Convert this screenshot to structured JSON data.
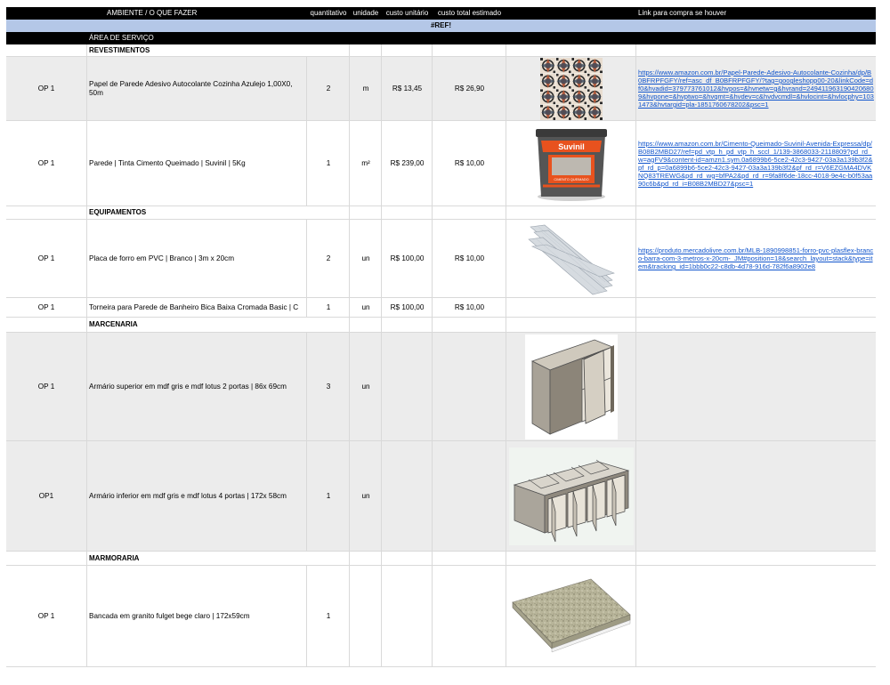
{
  "headers": {
    "ambiente": "AMBIENTE / O QUE FAZER",
    "quantitativo": "quantitativo",
    "unidade": "unidade",
    "custo_unitario": "custo unitário",
    "custo_total": "custo total estimado",
    "link": "Link para compra se houver"
  },
  "ref_error": "#REF!",
  "section": "ÁREA DE SERVIÇO",
  "categories": {
    "revestimentos": "REVESTIMENTOS",
    "equipamentos": "EQUIPAMENTOS",
    "marcenaria": "MARCENARIA",
    "marmoraria": "MARMORARIA"
  },
  "rows": [
    {
      "op": "OP 1",
      "desc": "Papel de Parede Adesivo Autocolante Cozinha Azulejo 1,00X0, 50m",
      "qty": "2",
      "unit": "m",
      "unit_cost": "R$ 13,45",
      "total_cost": "R$ 26,90",
      "image": "patterned-tile-wallpaper",
      "link": "https://www.amazon.com.br/Papel-Parede-Adesivo-Autocolante-Cozinha/dp/B0BFRPFGFY/ref=asc_df_B0BFRPFGFY/?tag=googleshopp00-20&linkCode=df0&hvadid=379773761012&hvpos=&hvnetw=g&hvrand=2494119631904206809&hvpone=&hvptwo=&hvqmt=&hvdev=c&hvdvcmdl=&hvlocint=&hvlocphy=1031473&hvtargid=pla-1851760678202&psc=1"
    },
    {
      "op": "OP 1",
      "desc": "Parede | Tinta Cimento Queimado | Suvinil | 5Kg",
      "qty": "1",
      "unit": "m²",
      "unit_cost": "R$ 239,00",
      "total_cost": "R$ 10,00",
      "image": "suvinil-paint-bucket",
      "brand": "Suvinil",
      "product_label": "CIMENTO QUEIMADO",
      "link": "https://www.amazon.com.br/Cimento-Queimado-Suvinil-Avenida-Expressa/dp/B08B2MBD27/ref=pd_vtp_h_pd_vtp_h_sccl_1/139-3868033-2118809?pd_rd_w=agFV9&content-id=amzn1.sym.0a6899b6-5ce2-42c3-9427-03a3a139b3f2&pf_rd_p=0a6899b6-5ce2-42c3-9427-03a3a139b3f2&pf_rd_r=V6EZGMA4DVKNQ83TREWG&pd_rd_wg=bfPA2&pd_rd_r=9fa8f6de-18cc-4018-9e4c-b0f53aa90c6b&pd_rd_i=B08B2MBD27&psc=1"
    },
    {
      "op": "OP 1",
      "desc": "Placa de forro em PVC | Branco | 3m x 20cm",
      "qty": "2",
      "unit": "un",
      "unit_cost": "R$ 100,00",
      "total_cost": "R$ 10,00",
      "image": "pvc-ceiling-panels",
      "link": "https://produto.mercadolivre.com.br/MLB-1890998851-forro-pvc-plasflex-branco-barra-com-3-metros-x-20cm-_JM#position=18&search_layout=stack&type=item&tracking_id=1bbb0c22-c8db-4d78-916d-782f6a8902e8"
    },
    {
      "op": "OP 1",
      "desc": "Torneira para Parede de Banheiro Bica Baixa Cromada Basic | C",
      "qty": "1",
      "unit": "un",
      "unit_cost": "R$ 100,00",
      "total_cost": "R$ 10,00"
    },
    {
      "op": "OP 1",
      "desc": "Armário superior em mdf gris e mdf lotus 2 portas | 86x 69cm",
      "qty": "3",
      "unit": "un",
      "image": "upper-cabinet-render"
    },
    {
      "op": "OP1",
      "desc": "Armário inferior em mdf gris e mdf lotus 4 portas | 172x 58cm",
      "qty": "1",
      "unit": "un",
      "image": "lower-cabinet-render"
    },
    {
      "op": "OP 1",
      "desc": "Bancada em granito fulget bege claro | 172x59cm",
      "qty": "1",
      "image": "granite-countertop-render"
    }
  ],
  "colors": {
    "header_bg": "#000000",
    "ref_bg": "#b4c7e7",
    "grey_rows": "#ececec",
    "link": "#1155cc"
  }
}
